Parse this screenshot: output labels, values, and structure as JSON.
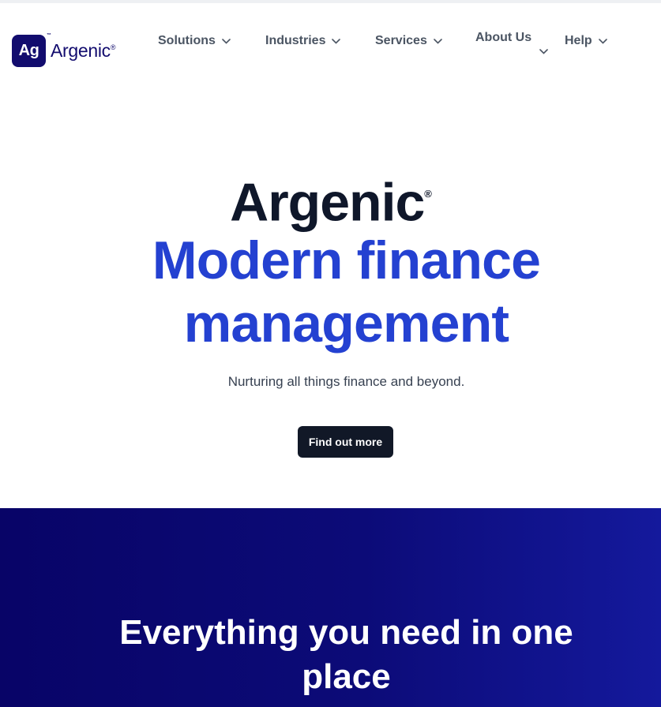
{
  "brand": {
    "badge": "Ag",
    "tm": "™",
    "name": "Argenic",
    "reg": "®"
  },
  "nav": {
    "items": [
      {
        "label": "Solutions",
        "icon": "chevron-down-icon"
      },
      {
        "label": "Industries",
        "icon": "chevron-down-icon"
      },
      {
        "label": "Services",
        "icon": "chevron-down-icon"
      },
      {
        "label": "About Us",
        "icon": "chevron-down-icon"
      },
      {
        "label": "Help",
        "icon": "chevron-down-icon"
      }
    ]
  },
  "hero": {
    "brand": "Argenic",
    "brand_mark": "®",
    "title_line1": "Modern finance",
    "title_line2": "management",
    "subtitle": "Nurturing all things finance and beyond.",
    "cta_label": "Find out more"
  },
  "band": {
    "title_line1": "Everything you need in one",
    "title_line2": "place"
  },
  "colors": {
    "brand_navy": "#120c6e",
    "hero_blue": "#2441d1",
    "heading_dark": "#0f172a",
    "cta_bg": "#111827",
    "nav_text": "#4b5563",
    "band_start": "#080467",
    "band_end": "#14199c"
  }
}
